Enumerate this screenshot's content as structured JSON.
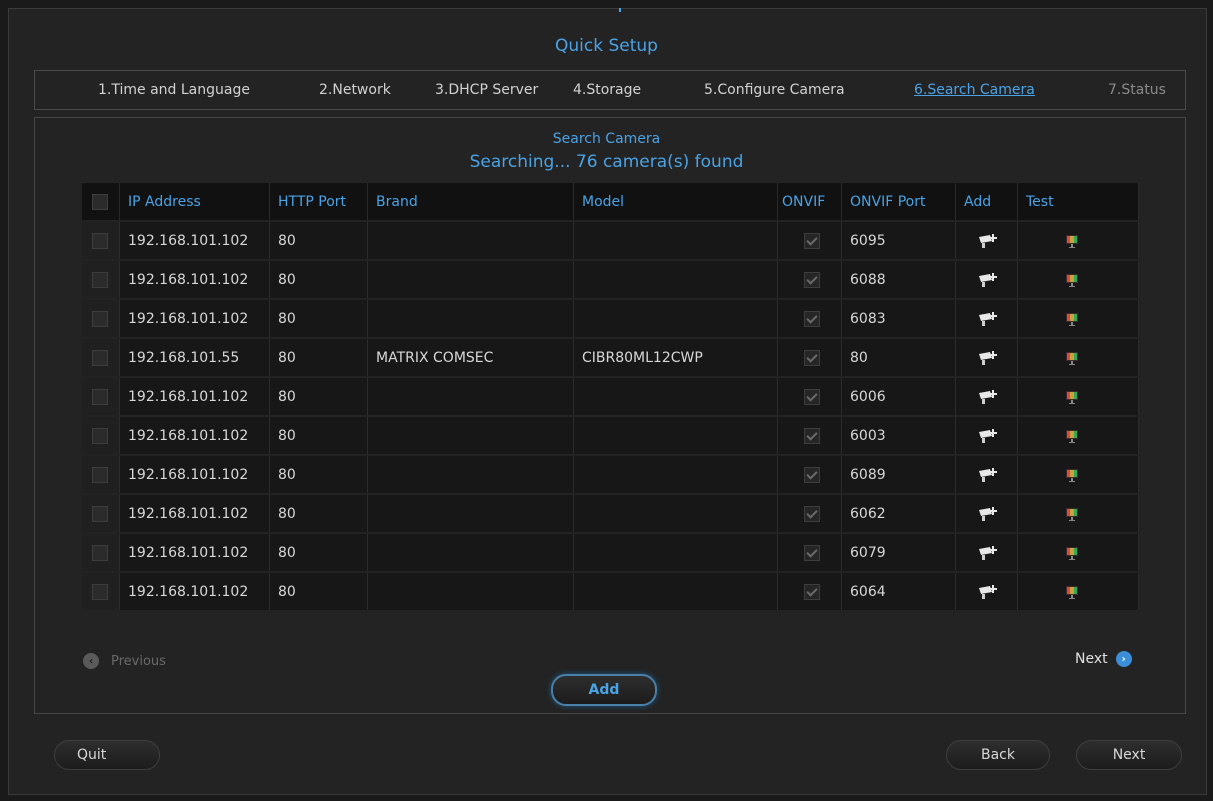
{
  "title": "Quick Setup",
  "steps": [
    {
      "label": "1.Time and Language"
    },
    {
      "label": "2.Network"
    },
    {
      "label": "3.DHCP Server"
    },
    {
      "label": "4.Storage"
    },
    {
      "label": "5.Configure Camera"
    },
    {
      "label": "6.Search Camera"
    },
    {
      "label": "7.Status"
    }
  ],
  "panel": {
    "subtitle": "Search Camera",
    "status": "Searching... 76 camera(s) found"
  },
  "table": {
    "headers": [
      "IP Address",
      "HTTP Port",
      "Brand",
      "Model",
      "ONVIF",
      "ONVIF Port",
      "Add",
      "Test"
    ],
    "rows": [
      {
        "ip": "192.168.101.102",
        "http_port": "80",
        "brand": "",
        "model": "",
        "onvif": true,
        "onvif_port": "6095"
      },
      {
        "ip": "192.168.101.102",
        "http_port": "80",
        "brand": "",
        "model": "",
        "onvif": true,
        "onvif_port": "6088"
      },
      {
        "ip": "192.168.101.102",
        "http_port": "80",
        "brand": "",
        "model": "",
        "onvif": true,
        "onvif_port": "6083"
      },
      {
        "ip": "192.168.101.55",
        "http_port": "80",
        "brand": "MATRIX COMSEC",
        "model": "CIBR80ML12CWP",
        "onvif": true,
        "onvif_port": "80"
      },
      {
        "ip": "192.168.101.102",
        "http_port": "80",
        "brand": "",
        "model": "",
        "onvif": true,
        "onvif_port": "6006"
      },
      {
        "ip": "192.168.101.102",
        "http_port": "80",
        "brand": "",
        "model": "",
        "onvif": true,
        "onvif_port": "6003"
      },
      {
        "ip": "192.168.101.102",
        "http_port": "80",
        "brand": "",
        "model": "",
        "onvif": true,
        "onvif_port": "6089"
      },
      {
        "ip": "192.168.101.102",
        "http_port": "80",
        "brand": "",
        "model": "",
        "onvif": true,
        "onvif_port": "6062"
      },
      {
        "ip": "192.168.101.102",
        "http_port": "80",
        "brand": "",
        "model": "",
        "onvif": true,
        "onvif_port": "6079"
      },
      {
        "ip": "192.168.101.102",
        "http_port": "80",
        "brand": "",
        "model": "",
        "onvif": true,
        "onvif_port": "6064"
      }
    ]
  },
  "pager": {
    "previous_label": "Previous",
    "next_label": "Next"
  },
  "buttons": {
    "add": "Add",
    "quit": "Quit",
    "back": "Back",
    "next": "Next"
  },
  "colors": {
    "accent": "#4aa3e6",
    "background": "#232323",
    "row": "#171717"
  },
  "icons": {
    "add": "camera-add-icon",
    "test": "monitor-test-icon",
    "prev": "chevron-left-circle-icon",
    "next": "chevron-right-circle-icon"
  }
}
